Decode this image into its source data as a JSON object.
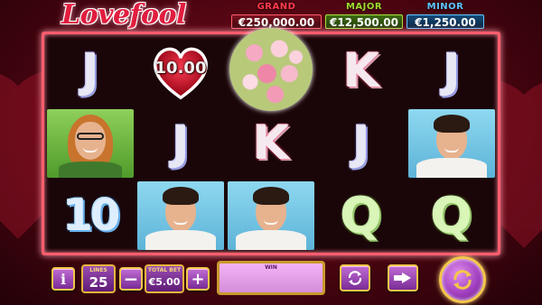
{
  "game": {
    "logo": "Lovefool"
  },
  "jackpots": {
    "grand": {
      "title": "GRAND",
      "value": "€250,000.00"
    },
    "major": {
      "title": "MAJOR",
      "value": "€12,500.00"
    },
    "minor": {
      "title": "MINOR",
      "value": "€1,250.00"
    }
  },
  "reels": {
    "row1": [
      "J",
      "heart-10.00",
      "bouquet",
      "K",
      "J"
    ],
    "row2": [
      "woman-portrait",
      "J",
      "K",
      "J",
      "man-portrait"
    ],
    "row3": [
      "10",
      "man-portrait",
      "man-portrait",
      "Q",
      "Q"
    ],
    "heart_value": "10.00",
    "letters": {
      "j": "J",
      "k": "K",
      "q": "Q",
      "ten": "10"
    }
  },
  "controls": {
    "info_label": "i",
    "lines_label": "LINES",
    "lines_value": "25",
    "minus_label": "−",
    "bet_label": "TOTAL BET",
    "bet_value": "€5.00",
    "plus_label": "+",
    "win_label": "WIN",
    "win_value": ""
  },
  "colors": {
    "grand": "#ff3b4b",
    "major": "#a0dc2e",
    "minor": "#5fc4ff",
    "button_border": "#f4c64a",
    "button_fill": "#a13fbf",
    "frame": "#ff5d6e"
  }
}
